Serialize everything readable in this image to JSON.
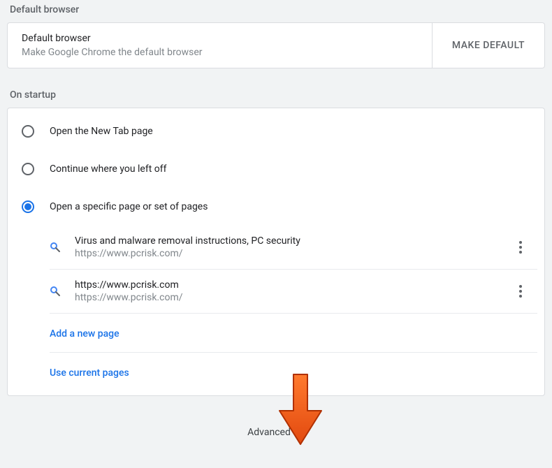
{
  "defaultBrowser": {
    "sectionTitle": "Default browser",
    "title": "Default browser",
    "description": "Make Google Chrome the default browser",
    "buttonLabel": "MAKE DEFAULT"
  },
  "onStartup": {
    "sectionTitle": "On startup",
    "options": [
      {
        "label": "Open the New Tab page",
        "selected": false
      },
      {
        "label": "Continue where you left off",
        "selected": false
      },
      {
        "label": "Open a specific page or set of pages",
        "selected": true
      }
    ],
    "pages": [
      {
        "title": "Virus and malware removal instructions, PC security",
        "url": "https://www.pcrisk.com/"
      },
      {
        "title": "https://www.pcrisk.com",
        "url": "https://www.pcrisk.com/"
      }
    ],
    "addPageLabel": "Add a new page",
    "useCurrentLabel": "Use current pages"
  },
  "advanced": {
    "label": "Advanced"
  }
}
